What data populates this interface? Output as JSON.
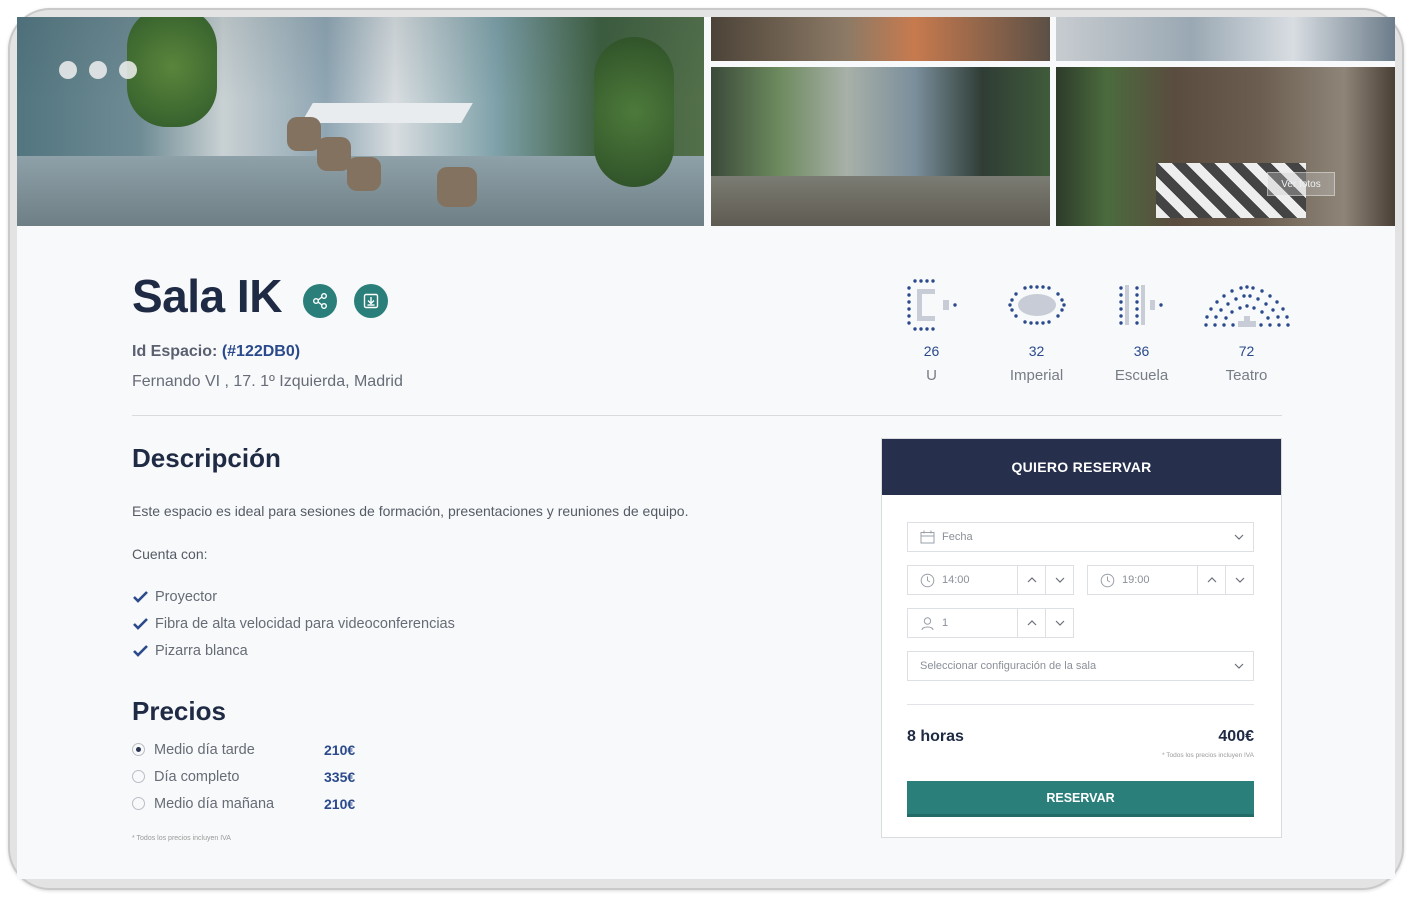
{
  "gallery": {
    "see_photos": "Ver fotos"
  },
  "room": {
    "title": "Sala IK",
    "id_label": "Id Espacio:",
    "id_value": "(#122DB0)",
    "address": "Fernando VI , 17. 1º Izquierda, Madrid"
  },
  "capacities": [
    {
      "icon": "u-layout-icon",
      "count": "26",
      "label": "U"
    },
    {
      "icon": "imperial-layout-icon",
      "count": "32",
      "label": "Imperial"
    },
    {
      "icon": "school-layout-icon",
      "count": "36",
      "label": "Escuela"
    },
    {
      "icon": "theatre-layout-icon",
      "count": "72",
      "label": "Teatro"
    }
  ],
  "description": {
    "heading": "Descripción",
    "text": "Este espacio es ideal para sesiones de formación, presentaciones y reuniones de equipo.",
    "includes_label": "Cuenta con:",
    "features": [
      "Proyector",
      "Fibra de alta velocidad para videoconferencias",
      "Pizarra blanca"
    ]
  },
  "prices": {
    "heading": "Precios",
    "items": [
      {
        "name": "Medio día tarde",
        "price": "210€",
        "selected": true
      },
      {
        "name": "Día completo",
        "price": "335€",
        "selected": false
      },
      {
        "name": "Medio día mañana",
        "price": "210€",
        "selected": false
      }
    ],
    "footnote": "* Todos los precios incluyen IVA"
  },
  "booking": {
    "header": "QUIERO RESERVAR",
    "date_placeholder": "Fecha",
    "start_time": "14:00",
    "end_time": "19:00",
    "people": "1",
    "config_placeholder": "Seleccionar configuración de la sala",
    "duration": "8 horas",
    "total": "400€",
    "footnote": "* Todos los precios incluyen IVA",
    "submit": "RESERVAR"
  },
  "colors": {
    "navy": "#26304d",
    "teal": "#2a7f7a",
    "accent_blue": "#2b4a8c"
  }
}
